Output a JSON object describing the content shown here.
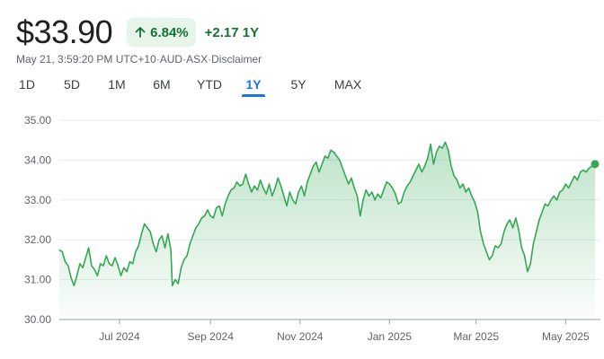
{
  "header": {
    "price": "$33.90",
    "pct_change": "6.84%",
    "abs_change": "+2.17 1Y",
    "arrow_icon": "arrow-up-icon",
    "positive_color": "#137333",
    "badge_bg": "#e6f4ea"
  },
  "meta": {
    "timestamp": "May 21, 3:59:20 PM UTC+10",
    "currency": "AUD",
    "exchange": "ASX",
    "disclaimer": "Disclaimer",
    "separator": " · "
  },
  "range_tabs": [
    {
      "label": "1D",
      "active": false
    },
    {
      "label": "5D",
      "active": false
    },
    {
      "label": "1M",
      "active": false
    },
    {
      "label": "6M",
      "active": false
    },
    {
      "label": "YTD",
      "active": false
    },
    {
      "label": "1Y",
      "active": true
    },
    {
      "label": "5Y",
      "active": false
    },
    {
      "label": "MAX",
      "active": false
    }
  ],
  "chart_data": {
    "type": "area",
    "line_color": "#34a853",
    "grid": true,
    "ylim": [
      30.0,
      35.0
    ],
    "y_ticks": [
      "35.00",
      "34.00",
      "33.00",
      "32.00",
      "31.00",
      "30.00"
    ],
    "x_ticks": [
      {
        "label": "Jul 2024",
        "date": "2024-07-01"
      },
      {
        "label": "Sep 2024",
        "date": "2024-09-01"
      },
      {
        "label": "Nov 2024",
        "date": "2024-11-01"
      },
      {
        "label": "Jan 2025",
        "date": "2025-01-01"
      },
      {
        "label": "Mar 2025",
        "date": "2025-03-01"
      },
      {
        "label": "May 2025",
        "date": "2025-05-01"
      }
    ],
    "series": [
      {
        "points": [
          [
            "2024-05-21",
            31.75
          ],
          [
            "2024-05-23",
            31.7
          ],
          [
            "2024-05-25",
            31.45
          ],
          [
            "2024-05-27",
            31.35
          ],
          [
            "2024-05-29",
            31.05
          ],
          [
            "2024-05-31",
            30.85
          ],
          [
            "2024-06-02",
            31.1
          ],
          [
            "2024-06-04",
            31.4
          ],
          [
            "2024-06-06",
            31.3
          ],
          [
            "2024-06-08",
            31.55
          ],
          [
            "2024-06-10",
            31.8
          ],
          [
            "2024-06-12",
            31.35
          ],
          [
            "2024-06-14",
            31.25
          ],
          [
            "2024-06-16",
            31.1
          ],
          [
            "2024-06-18",
            31.4
          ],
          [
            "2024-06-20",
            31.35
          ],
          [
            "2024-06-22",
            31.6
          ],
          [
            "2024-06-24",
            31.4
          ],
          [
            "2024-06-26",
            31.35
          ],
          [
            "2024-06-28",
            31.55
          ],
          [
            "2024-06-30",
            31.35
          ],
          [
            "2024-07-02",
            31.1
          ],
          [
            "2024-07-04",
            31.3
          ],
          [
            "2024-07-06",
            31.2
          ],
          [
            "2024-07-08",
            31.45
          ],
          [
            "2024-07-10",
            31.4
          ],
          [
            "2024-07-12",
            31.7
          ],
          [
            "2024-07-14",
            31.85
          ],
          [
            "2024-07-16",
            32.15
          ],
          [
            "2024-07-18",
            32.4
          ],
          [
            "2024-07-20",
            32.3
          ],
          [
            "2024-07-22",
            32.2
          ],
          [
            "2024-07-24",
            31.9
          ],
          [
            "2024-07-26",
            31.7
          ],
          [
            "2024-07-28",
            32.0
          ],
          [
            "2024-07-30",
            32.1
          ],
          [
            "2024-08-01",
            31.8
          ],
          [
            "2024-08-03",
            32.15
          ],
          [
            "2024-08-05",
            31.75
          ],
          [
            "2024-08-06",
            30.85
          ],
          [
            "2024-08-08",
            31.0
          ],
          [
            "2024-08-10",
            30.9
          ],
          [
            "2024-08-12",
            31.3
          ],
          [
            "2024-08-14",
            31.5
          ],
          [
            "2024-08-16",
            31.6
          ],
          [
            "2024-08-18",
            31.9
          ],
          [
            "2024-08-20",
            32.1
          ],
          [
            "2024-08-22",
            32.3
          ],
          [
            "2024-08-24",
            32.4
          ],
          [
            "2024-08-26",
            32.55
          ],
          [
            "2024-08-28",
            32.6
          ],
          [
            "2024-08-30",
            32.75
          ],
          [
            "2024-09-01",
            32.6
          ],
          [
            "2024-09-03",
            32.55
          ],
          [
            "2024-09-05",
            32.8
          ],
          [
            "2024-09-07",
            32.85
          ],
          [
            "2024-09-09",
            32.6
          ],
          [
            "2024-09-11",
            32.9
          ],
          [
            "2024-09-13",
            33.1
          ],
          [
            "2024-09-15",
            33.25
          ],
          [
            "2024-09-17",
            33.3
          ],
          [
            "2024-09-19",
            33.45
          ],
          [
            "2024-09-21",
            33.35
          ],
          [
            "2024-09-23",
            33.4
          ],
          [
            "2024-09-25",
            33.65
          ],
          [
            "2024-09-27",
            33.4
          ],
          [
            "2024-09-29",
            33.2
          ],
          [
            "2024-10-01",
            33.35
          ],
          [
            "2024-10-03",
            33.25
          ],
          [
            "2024-10-05",
            33.5
          ],
          [
            "2024-10-07",
            33.3
          ],
          [
            "2024-10-09",
            33.15
          ],
          [
            "2024-10-11",
            33.4
          ],
          [
            "2024-10-13",
            33.1
          ],
          [
            "2024-10-15",
            33.3
          ],
          [
            "2024-10-17",
            33.55
          ],
          [
            "2024-10-19",
            33.35
          ],
          [
            "2024-10-21",
            33.1
          ],
          [
            "2024-10-23",
            32.85
          ],
          [
            "2024-10-25",
            33.2
          ],
          [
            "2024-10-27",
            33.0
          ],
          [
            "2024-10-29",
            32.9
          ],
          [
            "2024-10-31",
            33.2
          ],
          [
            "2024-11-02",
            33.35
          ],
          [
            "2024-11-04",
            33.1
          ],
          [
            "2024-11-06",
            33.45
          ],
          [
            "2024-11-08",
            33.65
          ],
          [
            "2024-11-10",
            33.85
          ],
          [
            "2024-11-12",
            33.95
          ],
          [
            "2024-11-14",
            33.7
          ],
          [
            "2024-11-16",
            33.9
          ],
          [
            "2024-11-18",
            34.1
          ],
          [
            "2024-11-20",
            34.05
          ],
          [
            "2024-11-22",
            34.25
          ],
          [
            "2024-11-24",
            34.2
          ],
          [
            "2024-11-26",
            34.1
          ],
          [
            "2024-11-28",
            34.0
          ],
          [
            "2024-11-30",
            33.8
          ],
          [
            "2024-12-02",
            33.6
          ],
          [
            "2024-12-04",
            33.4
          ],
          [
            "2024-12-06",
            33.55
          ],
          [
            "2024-12-08",
            33.3
          ],
          [
            "2024-12-10",
            33.1
          ],
          [
            "2024-12-12",
            32.6
          ],
          [
            "2024-12-14",
            33.0
          ],
          [
            "2024-12-16",
            33.25
          ],
          [
            "2024-12-18",
            33.1
          ],
          [
            "2024-12-20",
            33.2
          ],
          [
            "2024-12-22",
            33.0
          ],
          [
            "2024-12-24",
            33.15
          ],
          [
            "2024-12-26",
            33.05
          ],
          [
            "2024-12-28",
            33.25
          ],
          [
            "2024-12-30",
            33.45
          ],
          [
            "2025-01-01",
            33.4
          ],
          [
            "2025-01-03",
            33.3
          ],
          [
            "2025-01-05",
            33.15
          ],
          [
            "2025-01-07",
            32.9
          ],
          [
            "2025-01-09",
            32.95
          ],
          [
            "2025-01-11",
            33.2
          ],
          [
            "2025-01-13",
            33.35
          ],
          [
            "2025-01-15",
            33.45
          ],
          [
            "2025-01-17",
            33.6
          ],
          [
            "2025-01-19",
            33.75
          ],
          [
            "2025-01-21",
            33.9
          ],
          [
            "2025-01-23",
            33.7
          ],
          [
            "2025-01-25",
            33.85
          ],
          [
            "2025-01-27",
            34.05
          ],
          [
            "2025-01-29",
            34.4
          ],
          [
            "2025-01-31",
            33.9
          ],
          [
            "2025-02-02",
            34.2
          ],
          [
            "2025-02-04",
            34.35
          ],
          [
            "2025-02-06",
            34.3
          ],
          [
            "2025-02-08",
            34.45
          ],
          [
            "2025-02-10",
            34.25
          ],
          [
            "2025-02-12",
            33.85
          ],
          [
            "2025-02-14",
            33.6
          ],
          [
            "2025-02-16",
            33.5
          ],
          [
            "2025-02-18",
            33.3
          ],
          [
            "2025-02-20",
            33.4
          ],
          [
            "2025-02-22",
            33.2
          ],
          [
            "2025-02-24",
            33.3
          ],
          [
            "2025-02-26",
            33.1
          ],
          [
            "2025-02-28",
            32.95
          ],
          [
            "2025-03-02",
            32.7
          ],
          [
            "2025-03-04",
            32.2
          ],
          [
            "2025-03-06",
            31.9
          ],
          [
            "2025-03-08",
            31.7
          ],
          [
            "2025-03-10",
            31.5
          ],
          [
            "2025-03-12",
            31.6
          ],
          [
            "2025-03-14",
            31.85
          ],
          [
            "2025-03-16",
            31.8
          ],
          [
            "2025-03-18",
            31.9
          ],
          [
            "2025-03-20",
            32.2
          ],
          [
            "2025-03-22",
            32.4
          ],
          [
            "2025-03-24",
            32.5
          ],
          [
            "2025-03-26",
            32.3
          ],
          [
            "2025-03-28",
            32.55
          ],
          [
            "2025-03-30",
            32.25
          ],
          [
            "2025-04-01",
            31.8
          ],
          [
            "2025-04-03",
            31.6
          ],
          [
            "2025-04-05",
            31.2
          ],
          [
            "2025-04-07",
            31.4
          ],
          [
            "2025-04-09",
            31.9
          ],
          [
            "2025-04-11",
            32.2
          ],
          [
            "2025-04-13",
            32.5
          ],
          [
            "2025-04-15",
            32.7
          ],
          [
            "2025-04-17",
            32.9
          ],
          [
            "2025-04-19",
            32.85
          ],
          [
            "2025-04-21",
            33.0
          ],
          [
            "2025-04-23",
            33.1
          ],
          [
            "2025-04-25",
            33.0
          ],
          [
            "2025-04-27",
            33.2
          ],
          [
            "2025-04-29",
            33.25
          ],
          [
            "2025-05-01",
            33.4
          ],
          [
            "2025-05-03",
            33.3
          ],
          [
            "2025-05-05",
            33.45
          ],
          [
            "2025-05-07",
            33.6
          ],
          [
            "2025-05-09",
            33.5
          ],
          [
            "2025-05-11",
            33.7
          ],
          [
            "2025-05-13",
            33.75
          ],
          [
            "2025-05-15",
            33.7
          ],
          [
            "2025-05-17",
            33.8
          ],
          [
            "2025-05-19",
            33.85
          ],
          [
            "2025-05-21",
            33.9
          ]
        ]
      }
    ]
  }
}
